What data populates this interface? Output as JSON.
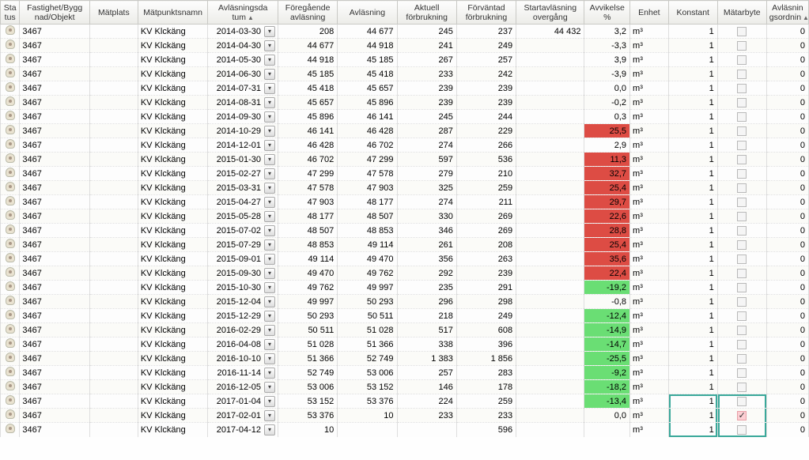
{
  "columns": [
    {
      "key": "status",
      "label": "Sta\ntus"
    },
    {
      "key": "fastighet",
      "label": "Fastighet/Bygg\nnad/Objekt"
    },
    {
      "key": "matplats",
      "label": "Mätplats"
    },
    {
      "key": "matpunktsnamn",
      "label": "Mätpunktsnamn"
    },
    {
      "key": "avlasningsdatum",
      "label": "Avläsningsda\ntum",
      "sort": true
    },
    {
      "key": "foregaende",
      "label": "Föregående\navläsning"
    },
    {
      "key": "avlasning",
      "label": "Avläsning"
    },
    {
      "key": "aktuell",
      "label": "Aktuell\nförbrukning"
    },
    {
      "key": "forvantad",
      "label": "Förväntad\nförbrukning"
    },
    {
      "key": "startavl",
      "label": "Startavläsning\novergång"
    },
    {
      "key": "avvikelse",
      "label": "Avvikelse\n%"
    },
    {
      "key": "enhet",
      "label": "Enhet"
    },
    {
      "key": "konstant",
      "label": "Konstant"
    },
    {
      "key": "matarbyte",
      "label": "Mätarbyte"
    },
    {
      "key": "order",
      "label": "Avläsnin\ngsordnin",
      "sort": true
    }
  ],
  "rows": [
    {
      "fast": "3467",
      "matpunkt": "KV Klckäng",
      "date": "2014-03-30",
      "prev": "208",
      "read": "44 677",
      "act": "245",
      "exp": "237",
      "start": "44 432",
      "dev": "3,2",
      "devClass": "",
      "unit": "m³",
      "konst": "1",
      "byte": false,
      "ord": "0"
    },
    {
      "fast": "3467",
      "matpunkt": "KV Klckäng",
      "date": "2014-04-30",
      "prev": "44 677",
      "read": "44 918",
      "act": "241",
      "exp": "249",
      "start": "",
      "dev": "-3,3",
      "devClass": "",
      "unit": "m³",
      "konst": "1",
      "byte": false,
      "ord": "0"
    },
    {
      "fast": "3467",
      "matpunkt": "KV Klckäng",
      "date": "2014-05-30",
      "prev": "44 918",
      "read": "45 185",
      "act": "267",
      "exp": "257",
      "start": "",
      "dev": "3,9",
      "devClass": "",
      "unit": "m³",
      "konst": "1",
      "byte": false,
      "ord": "0"
    },
    {
      "fast": "3467",
      "matpunkt": "KV Klckäng",
      "date": "2014-06-30",
      "prev": "45 185",
      "read": "45 418",
      "act": "233",
      "exp": "242",
      "start": "",
      "dev": "-3,9",
      "devClass": "",
      "unit": "m³",
      "konst": "1",
      "byte": false,
      "ord": "0"
    },
    {
      "fast": "3467",
      "matpunkt": "KV Klckäng",
      "date": "2014-07-31",
      "prev": "45 418",
      "read": "45 657",
      "act": "239",
      "exp": "239",
      "start": "",
      "dev": "0,0",
      "devClass": "",
      "unit": "m³",
      "konst": "1",
      "byte": false,
      "ord": "0"
    },
    {
      "fast": "3467",
      "matpunkt": "KV Klckäng",
      "date": "2014-08-31",
      "prev": "45 657",
      "read": "45 896",
      "act": "239",
      "exp": "239",
      "start": "",
      "dev": "-0,2",
      "devClass": "",
      "unit": "m³",
      "konst": "1",
      "byte": false,
      "ord": "0"
    },
    {
      "fast": "3467",
      "matpunkt": "KV Klckäng",
      "date": "2014-09-30",
      "prev": "45 896",
      "read": "46 141",
      "act": "245",
      "exp": "244",
      "start": "",
      "dev": "0,3",
      "devClass": "",
      "unit": "m³",
      "konst": "1",
      "byte": false,
      "ord": "0"
    },
    {
      "fast": "3467",
      "matpunkt": "KV Klckäng",
      "date": "2014-10-29",
      "prev": "46 141",
      "read": "46 428",
      "act": "287",
      "exp": "229",
      "start": "",
      "dev": "25,5",
      "devClass": "red",
      "unit": "m³",
      "konst": "1",
      "byte": false,
      "ord": "0"
    },
    {
      "fast": "3467",
      "matpunkt": "KV Klckäng",
      "date": "2014-12-01",
      "prev": "46 428",
      "read": "46 702",
      "act": "274",
      "exp": "266",
      "start": "",
      "dev": "2,9",
      "devClass": "",
      "unit": "m³",
      "konst": "1",
      "byte": false,
      "ord": "0"
    },
    {
      "fast": "3467",
      "matpunkt": "KV Klckäng",
      "date": "2015-01-30",
      "prev": "46 702",
      "read": "47 299",
      "act": "597",
      "exp": "536",
      "start": "",
      "dev": "11,3",
      "devClass": "red",
      "unit": "m³",
      "konst": "1",
      "byte": false,
      "ord": "0"
    },
    {
      "fast": "3467",
      "matpunkt": "KV Klckäng",
      "date": "2015-02-27",
      "prev": "47 299",
      "read": "47 578",
      "act": "279",
      "exp": "210",
      "start": "",
      "dev": "32,7",
      "devClass": "red",
      "unit": "m³",
      "konst": "1",
      "byte": false,
      "ord": "0"
    },
    {
      "fast": "3467",
      "matpunkt": "KV Klckäng",
      "date": "2015-03-31",
      "prev": "47 578",
      "read": "47 903",
      "act": "325",
      "exp": "259",
      "start": "",
      "dev": "25,4",
      "devClass": "red",
      "unit": "m³",
      "konst": "1",
      "byte": false,
      "ord": "0"
    },
    {
      "fast": "3467",
      "matpunkt": "KV Klckäng",
      "date": "2015-04-27",
      "prev": "47 903",
      "read": "48 177",
      "act": "274",
      "exp": "211",
      "start": "",
      "dev": "29,7",
      "devClass": "red",
      "unit": "m³",
      "konst": "1",
      "byte": false,
      "ord": "0"
    },
    {
      "fast": "3467",
      "matpunkt": "KV Klckäng",
      "date": "2015-05-28",
      "prev": "48 177",
      "read": "48 507",
      "act": "330",
      "exp": "269",
      "start": "",
      "dev": "22,6",
      "devClass": "red",
      "unit": "m³",
      "konst": "1",
      "byte": false,
      "ord": "0"
    },
    {
      "fast": "3467",
      "matpunkt": "KV Klckäng",
      "date": "2015-07-02",
      "prev": "48 507",
      "read": "48 853",
      "act": "346",
      "exp": "269",
      "start": "",
      "dev": "28,8",
      "devClass": "red",
      "unit": "m³",
      "konst": "1",
      "byte": false,
      "ord": "0"
    },
    {
      "fast": "3467",
      "matpunkt": "KV Klckäng",
      "date": "2015-07-29",
      "prev": "48 853",
      "read": "49 114",
      "act": "261",
      "exp": "208",
      "start": "",
      "dev": "25,4",
      "devClass": "red",
      "unit": "m³",
      "konst": "1",
      "byte": false,
      "ord": "0"
    },
    {
      "fast": "3467",
      "matpunkt": "KV Klckäng",
      "date": "2015-09-01",
      "prev": "49 114",
      "read": "49 470",
      "act": "356",
      "exp": "263",
      "start": "",
      "dev": "35,6",
      "devClass": "red",
      "unit": "m³",
      "konst": "1",
      "byte": false,
      "ord": "0"
    },
    {
      "fast": "3467",
      "matpunkt": "KV Klckäng",
      "date": "2015-09-30",
      "prev": "49 470",
      "read": "49 762",
      "act": "292",
      "exp": "239",
      "start": "",
      "dev": "22,4",
      "devClass": "red",
      "unit": "m³",
      "konst": "1",
      "byte": false,
      "ord": "0"
    },
    {
      "fast": "3467",
      "matpunkt": "KV Klckäng",
      "date": "2015-10-30",
      "prev": "49 762",
      "read": "49 997",
      "act": "235",
      "exp": "291",
      "start": "",
      "dev": "-19,2",
      "devClass": "green",
      "unit": "m³",
      "konst": "1",
      "byte": false,
      "ord": "0"
    },
    {
      "fast": "3467",
      "matpunkt": "KV Klckäng",
      "date": "2015-12-04",
      "prev": "49 997",
      "read": "50 293",
      "act": "296",
      "exp": "298",
      "start": "",
      "dev": "-0,8",
      "devClass": "",
      "unit": "m³",
      "konst": "1",
      "byte": false,
      "ord": "0"
    },
    {
      "fast": "3467",
      "matpunkt": "KV Klckäng",
      "date": "2015-12-29",
      "prev": "50 293",
      "read": "50 511",
      "act": "218",
      "exp": "249",
      "start": "",
      "dev": "-12,4",
      "devClass": "green",
      "unit": "m³",
      "konst": "1",
      "byte": false,
      "ord": "0"
    },
    {
      "fast": "3467",
      "matpunkt": "KV Klckäng",
      "date": "2016-02-29",
      "prev": "50 511",
      "read": "51 028",
      "act": "517",
      "exp": "608",
      "start": "",
      "dev": "-14,9",
      "devClass": "green",
      "unit": "m³",
      "konst": "1",
      "byte": false,
      "ord": "0"
    },
    {
      "fast": "3467",
      "matpunkt": "KV Klckäng",
      "date": "2016-04-08",
      "prev": "51 028",
      "read": "51 366",
      "act": "338",
      "exp": "396",
      "start": "",
      "dev": "-14,7",
      "devClass": "green",
      "unit": "m³",
      "konst": "1",
      "byte": false,
      "ord": "0"
    },
    {
      "fast": "3467",
      "matpunkt": "KV Klckäng",
      "date": "2016-10-10",
      "prev": "51 366",
      "read": "52 749",
      "act": "1 383",
      "exp": "1 856",
      "start": "",
      "dev": "-25,5",
      "devClass": "green",
      "unit": "m³",
      "konst": "1",
      "byte": false,
      "ord": "0"
    },
    {
      "fast": "3467",
      "matpunkt": "KV Klckäng",
      "date": "2016-11-14",
      "prev": "52 749",
      "read": "53 006",
      "act": "257",
      "exp": "283",
      "start": "",
      "dev": "-9,2",
      "devClass": "green",
      "unit": "m³",
      "konst": "1",
      "byte": false,
      "ord": "0"
    },
    {
      "fast": "3467",
      "matpunkt": "KV Klckäng",
      "date": "2016-12-05",
      "prev": "53 006",
      "read": "53 152",
      "act": "146",
      "exp": "178",
      "start": "",
      "dev": "-18,2",
      "devClass": "green",
      "unit": "m³",
      "konst": "1",
      "byte": false,
      "ord": "0"
    },
    {
      "fast": "3467",
      "matpunkt": "KV Klckäng",
      "date": "2017-01-04",
      "prev": "53 152",
      "read": "53 376",
      "act": "224",
      "exp": "259",
      "start": "",
      "dev": "-13,4",
      "devClass": "green",
      "unit": "m³",
      "konst": "1",
      "byte": false,
      "ord": "0",
      "hl": "top"
    },
    {
      "fast": "3467",
      "matpunkt": "KV Klckäng",
      "date": "2017-02-01",
      "prev": "53 376",
      "read": "10",
      "act": "233",
      "exp": "233",
      "start": "",
      "dev": "0,0",
      "devClass": "",
      "unit": "m³",
      "konst": "1",
      "byte": true,
      "bytePink": true,
      "ord": "0",
      "hl": "mid"
    },
    {
      "fast": "3467",
      "matpunkt": "KV Klckäng",
      "date": "2017-04-12",
      "prev": "10",
      "read": "",
      "act": "",
      "exp": "596",
      "start": "",
      "dev": "",
      "devClass": "",
      "unit": "m³",
      "konst": "1",
      "byte": false,
      "ord": "0",
      "hl": "bot"
    }
  ]
}
